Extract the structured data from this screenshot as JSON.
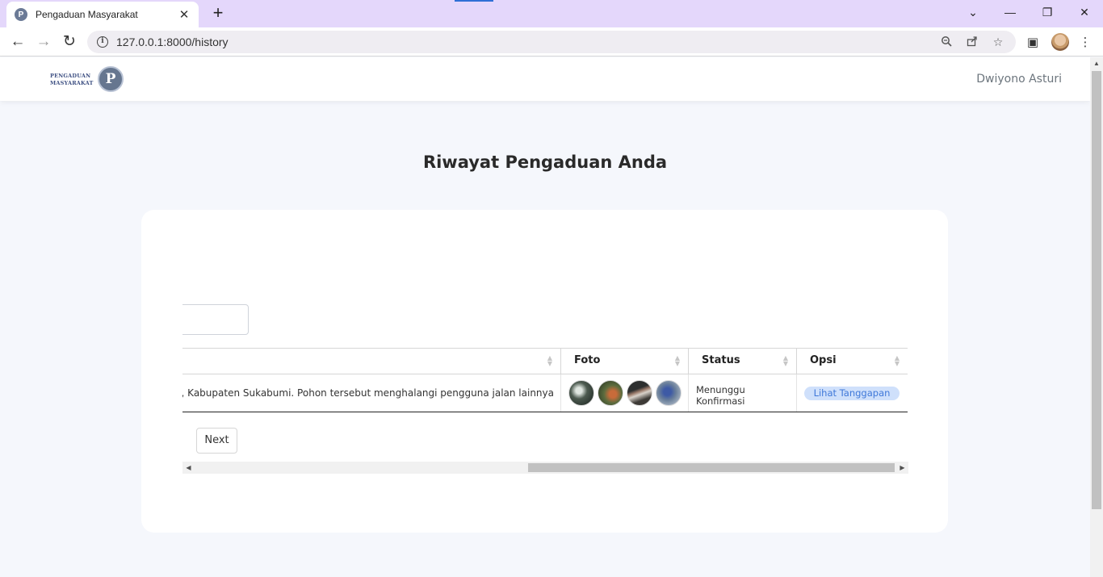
{
  "browser": {
    "tab_title": "Pengaduan Masyarakat",
    "favicon_letter": "P",
    "tab_close": "✕",
    "new_tab": "+",
    "url": "127.0.0.1:8000/history",
    "window_controls": {
      "tabs_menu": "⌄",
      "minimize": "—",
      "restore": "❐",
      "close": "✕"
    },
    "nav": {
      "back": "←",
      "forward": "→",
      "reload": "↻"
    },
    "omnibox_icons": {
      "zoom": "zoom-icon",
      "share": "share-icon",
      "star": "☆"
    },
    "toolbar_icons": {
      "side_panel": "▣",
      "menu": "⋮"
    },
    "accent_color": "#2f6fd6",
    "tabbar_color": "#e4d7fb"
  },
  "navbar": {
    "logo_line1": "PENGADUAN",
    "logo_line2": "MASYARAKAT",
    "logo_letter": "P",
    "user_name": "Dwiyono Asturi"
  },
  "page": {
    "title": "Riwayat Pengaduan Anda"
  },
  "table": {
    "columns": [
      {
        "label": ""
      },
      {
        "label": "Foto"
      },
      {
        "label": "Status"
      },
      {
        "label": "Opsi"
      }
    ],
    "rows": [
      {
        "description": "ke Sukabumi, Kabupaten Sukabumi. Pohon tersebut menghalangi pengguna jalan lainnya",
        "photos": [
          "photo-1",
          "photo-2",
          "photo-3",
          "photo-4"
        ],
        "status": "Menunggu Konfirmasi",
        "action_label": "Lihat Tanggapan"
      }
    ],
    "status_badge_color": "#cfe0fb"
  },
  "pagination": {
    "next_label": "Next"
  }
}
